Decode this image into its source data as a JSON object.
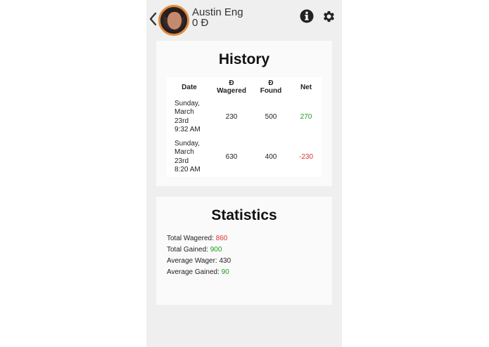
{
  "header": {
    "user_name": "Austin Eng",
    "balance": "0 Đ",
    "icons": {
      "back": "chevron-left-icon",
      "info": "info-circle-icon",
      "settings": "gear-icon"
    }
  },
  "history": {
    "title": "History",
    "columns": [
      "Date",
      "Đ Wagered",
      "Đ Found",
      "Net"
    ],
    "column_lines": [
      [
        "Date"
      ],
      [
        "Đ",
        "Wagered"
      ],
      [
        "Đ",
        "Found"
      ],
      [
        "Net"
      ]
    ],
    "rows": [
      {
        "date_lines": [
          "Sunday,",
          "March",
          "23rd",
          "9:32 AM"
        ],
        "wagered": "230",
        "found": "500",
        "net": "270",
        "net_color": "#1f9a1f"
      },
      {
        "date_lines": [
          "Sunday,",
          "March",
          "23rd",
          "8:20 AM"
        ],
        "wagered": "630",
        "found": "400",
        "net": "-230",
        "net_color": "#e23030"
      }
    ]
  },
  "statistics": {
    "title": "Statistics",
    "items": [
      {
        "label": "Total Wagered:",
        "value": "860",
        "color": "#e23030"
      },
      {
        "label": "Total Gained:",
        "value": "900",
        "color": "#1f9a1f"
      },
      {
        "label": "Average Wager:",
        "value": "430",
        "color": "#222222"
      },
      {
        "label": "Average Gained:",
        "value": "90",
        "color": "#1f9a1f"
      }
    ]
  }
}
